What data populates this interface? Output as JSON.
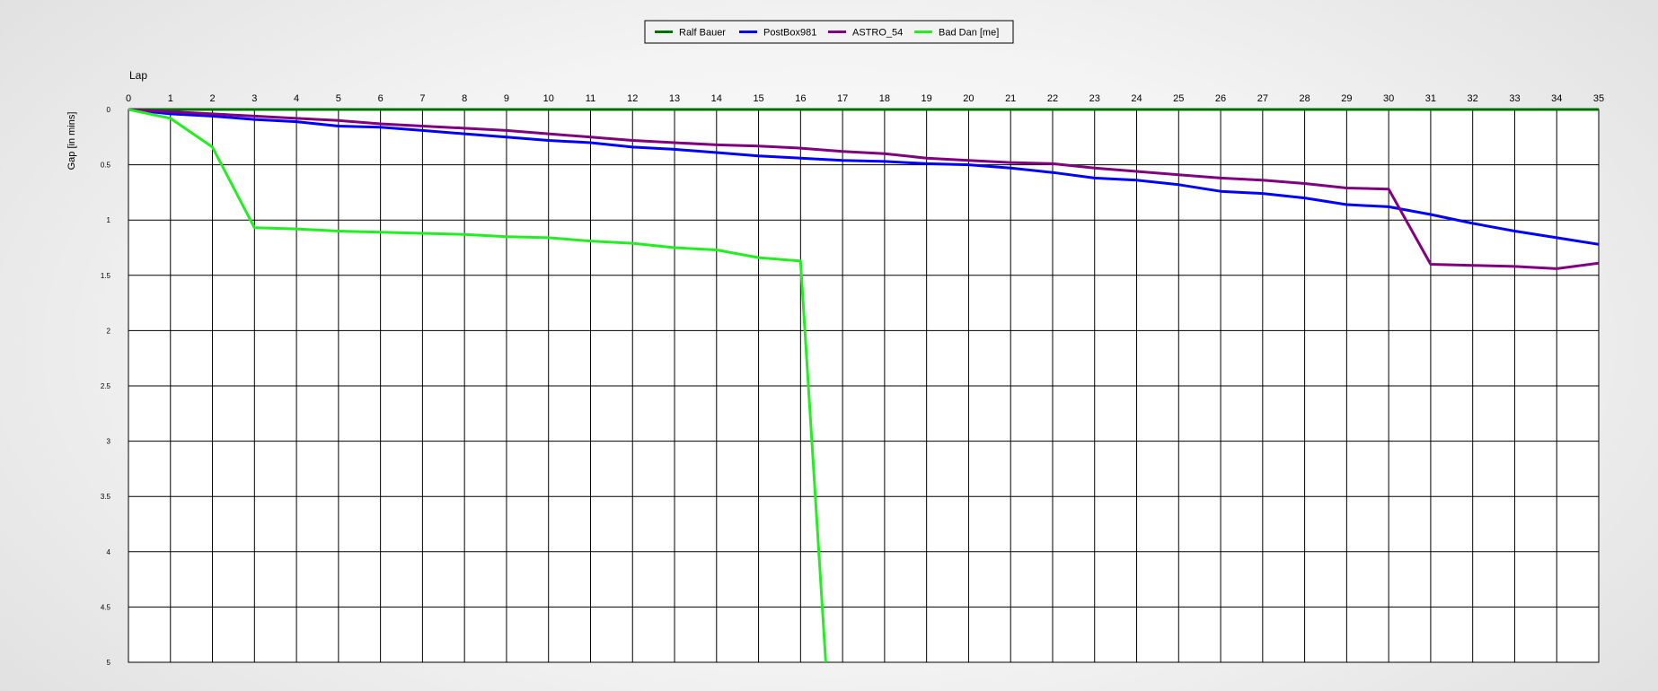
{
  "chart_data": {
    "type": "line",
    "xlabel": "Lap",
    "ylabel": "Gap [in mins]",
    "xlim": [
      0,
      35
    ],
    "ylim": [
      0,
      5
    ],
    "y_inverted": true,
    "grid": true,
    "legend_position": "top-center",
    "x_ticks": [
      0,
      1,
      2,
      3,
      4,
      5,
      6,
      7,
      8,
      9,
      10,
      11,
      12,
      13,
      14,
      15,
      16,
      17,
      18,
      19,
      20,
      21,
      22,
      23,
      24,
      25,
      26,
      27,
      28,
      29,
      30,
      31,
      32,
      33,
      34,
      35
    ],
    "y_ticks": [
      {
        "value": 0,
        "label": "0"
      },
      {
        "value": 0.5,
        "label": "0.5"
      },
      {
        "value": 1,
        "label": "1"
      },
      {
        "value": 1.5,
        "label": "1.5"
      },
      {
        "value": 2,
        "label": "2"
      },
      {
        "value": 2.5,
        "label": "2.5"
      },
      {
        "value": 3,
        "label": "3"
      },
      {
        "value": 3.5,
        "label": "3.5"
      },
      {
        "value": 4,
        "label": "4"
      },
      {
        "value": 4.5,
        "label": "4.5"
      },
      {
        "value": 5,
        "label": "5"
      }
    ],
    "series": [
      {
        "name": "Ralf Bauer",
        "color": "#007000",
        "x": [
          0,
          1,
          2,
          3,
          4,
          5,
          6,
          7,
          8,
          9,
          10,
          11,
          12,
          13,
          14,
          15,
          16,
          17,
          18,
          19,
          20,
          21,
          22,
          23,
          24,
          25,
          26,
          27,
          28,
          29,
          30,
          31,
          32,
          33,
          34,
          35
        ],
        "y": [
          0,
          0,
          0,
          0,
          0,
          0,
          0,
          0,
          0,
          0,
          0,
          0,
          0,
          0,
          0,
          0,
          0,
          0,
          0,
          0,
          0,
          0,
          0,
          0,
          0,
          0,
          0,
          0,
          0,
          0,
          0,
          0,
          0,
          0,
          0,
          0
        ]
      },
      {
        "name": "PostBox981",
        "color": "#0000ff",
        "x": [
          0,
          1,
          2,
          3,
          4,
          5,
          6,
          7,
          8,
          9,
          10,
          11,
          12,
          13,
          14,
          15,
          16,
          17,
          18,
          19,
          20,
          21,
          22,
          23,
          24,
          25,
          26,
          27,
          28,
          29,
          30,
          31,
          32,
          33,
          34,
          35
        ],
        "y": [
          0,
          0.04,
          0.06,
          0.09,
          0.11,
          0.15,
          0.16,
          0.19,
          0.22,
          0.25,
          0.28,
          0.3,
          0.34,
          0.36,
          0.39,
          0.42,
          0.44,
          0.46,
          0.47,
          0.49,
          0.5,
          0.53,
          0.57,
          0.62,
          0.64,
          0.68,
          0.74,
          0.76,
          0.8,
          0.86,
          0.88,
          0.95,
          1.03,
          1.1,
          1.16,
          1.22
        ]
      },
      {
        "name": "ASTRO_54",
        "color": "#800080",
        "x": [
          0,
          1,
          2,
          3,
          4,
          5,
          6,
          7,
          8,
          9,
          10,
          11,
          12,
          13,
          14,
          15,
          16,
          17,
          18,
          19,
          20,
          21,
          22,
          23,
          24,
          25,
          26,
          27,
          28,
          29,
          30,
          31,
          32,
          33,
          34,
          35
        ],
        "y": [
          0,
          0.02,
          0.04,
          0.06,
          0.08,
          0.1,
          0.13,
          0.15,
          0.17,
          0.19,
          0.22,
          0.25,
          0.28,
          0.3,
          0.32,
          0.33,
          0.35,
          0.38,
          0.4,
          0.44,
          0.46,
          0.48,
          0.49,
          0.53,
          0.56,
          0.59,
          0.62,
          0.64,
          0.67,
          0.71,
          0.72,
          1.4,
          1.41,
          1.42,
          1.44,
          1.39
        ]
      },
      {
        "name": "Bad Dan [me]",
        "color": "#22ee22",
        "x": [
          0,
          1,
          2,
          3,
          4,
          5,
          6,
          7,
          8,
          9,
          10,
          11,
          12,
          13,
          14,
          15,
          16,
          16.6
        ],
        "y": [
          0,
          0.08,
          0.34,
          1.07,
          1.08,
          1.1,
          1.11,
          1.12,
          1.13,
          1.15,
          1.16,
          1.19,
          1.21,
          1.25,
          1.27,
          1.34,
          1.37,
          5
        ]
      }
    ]
  }
}
